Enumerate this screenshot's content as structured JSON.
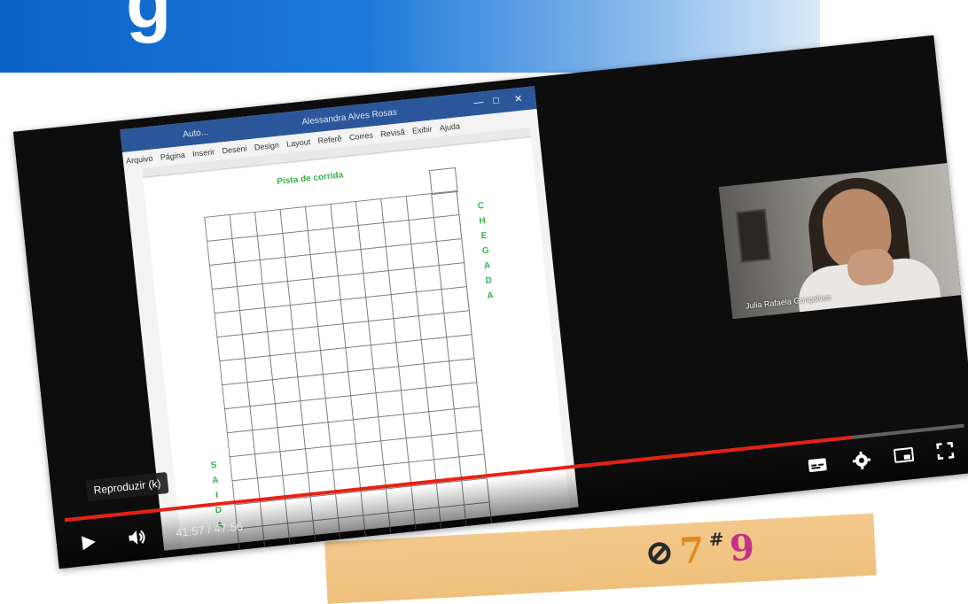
{
  "banner": {
    "letter": "g"
  },
  "word": {
    "title_left": "Auto...",
    "title_user": "Alessandra Alves Rosas",
    "menu": [
      "Arquivo",
      "Página",
      "Inserir",
      "Deseni",
      "Design",
      "Layout",
      "Referê",
      "Corres",
      "Revisã",
      "Exibir",
      "Ajuda"
    ],
    "doc_title": "Pista de corrida",
    "finish_letters": [
      "C",
      "H",
      "E",
      "G",
      "A",
      "D",
      "A"
    ],
    "start_letters": [
      "S",
      "A",
      "I",
      "D",
      "A"
    ]
  },
  "webcam": {
    "name": "Julia Rafaela Gonçalves"
  },
  "player": {
    "tooltip": "Reproduzir (k)",
    "time": "41:57 / 47:56",
    "progress": 0.875
  },
  "icons": {
    "play": "play-icon",
    "volume": "volume-icon",
    "subtitles": "subtitles-icon",
    "settings": "gear-icon",
    "miniplayer": "miniplayer-icon",
    "fullscreen": "fullscreen-icon"
  },
  "colors": {
    "banner_blue": "#0a63c9",
    "progress_red": "#e62117",
    "doc_green": "#36b24a",
    "word_blue": "#2b579a"
  }
}
